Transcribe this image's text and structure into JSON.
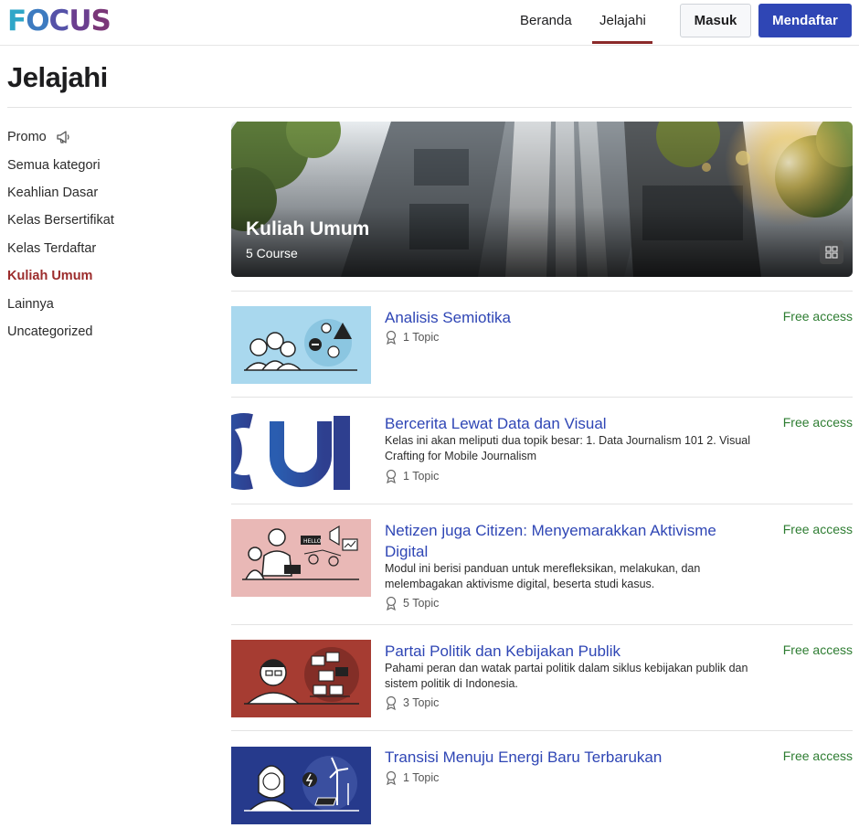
{
  "header": {
    "logo": [
      "F",
      "O",
      "C",
      "U",
      "S"
    ],
    "nav": [
      {
        "label": "Beranda"
      },
      {
        "label": "Jelajahi"
      }
    ],
    "login_label": "Masuk",
    "register_label": "Mendaftar"
  },
  "page": {
    "title": "Jelajahi"
  },
  "sidebar": {
    "items": [
      {
        "label": "Promo",
        "icon": "megaphone-icon"
      },
      {
        "label": "Semua kategori"
      },
      {
        "label": "Keahlian Dasar"
      },
      {
        "label": "Kelas Bersertifikat"
      },
      {
        "label": "Kelas Terdaftar"
      },
      {
        "label": "Kuliah Umum",
        "active": true
      },
      {
        "label": "Lainnya"
      },
      {
        "label": "Uncategorized"
      }
    ]
  },
  "banner": {
    "title": "Kuliah Umum",
    "subtitle": "5 Course",
    "icon": "grid-icon"
  },
  "courses": [
    {
      "title": "Analisis Semiotika",
      "description": "",
      "topics": "1 Topic",
      "access": "Free access",
      "thumb_color": "#a9d8ee"
    },
    {
      "title": "Bercerita Lewat Data dan Visual",
      "description": "Kelas ini akan meliputi dua topik besar: 1. Data Journalism 101 2. Visual Crafting for Mobile Journalism",
      "topics": "1 Topic",
      "access": "Free access",
      "thumb_color": "#ffffff"
    },
    {
      "title": "Netizen juga Citizen: Menyemarakkan Aktivisme Digital",
      "description": "Modul ini berisi panduan untuk merefleksikan, melakukan, dan melembagakan aktivisme digital, beserta studi kasus.",
      "topics": "5 Topic",
      "access": "Free access",
      "thumb_color": "#e9b8b6"
    },
    {
      "title": "Partai Politik dan Kebijakan Publik",
      "description": "Pahami peran dan watak partai politik dalam siklus kebijakan publik dan sistem politik di Indonesia.",
      "topics": "3 Topic",
      "access": "Free access",
      "thumb_color": "#a63c32"
    },
    {
      "title": "Transisi Menuju Energi Baru Terbarukan",
      "description": "",
      "topics": "1 Topic",
      "access": "Free access",
      "thumb_color": "#263a8c"
    }
  ],
  "colors": {
    "primary": "#2f46b5",
    "active_category": "#9c2c2c",
    "free_access": "#2e7d32"
  }
}
